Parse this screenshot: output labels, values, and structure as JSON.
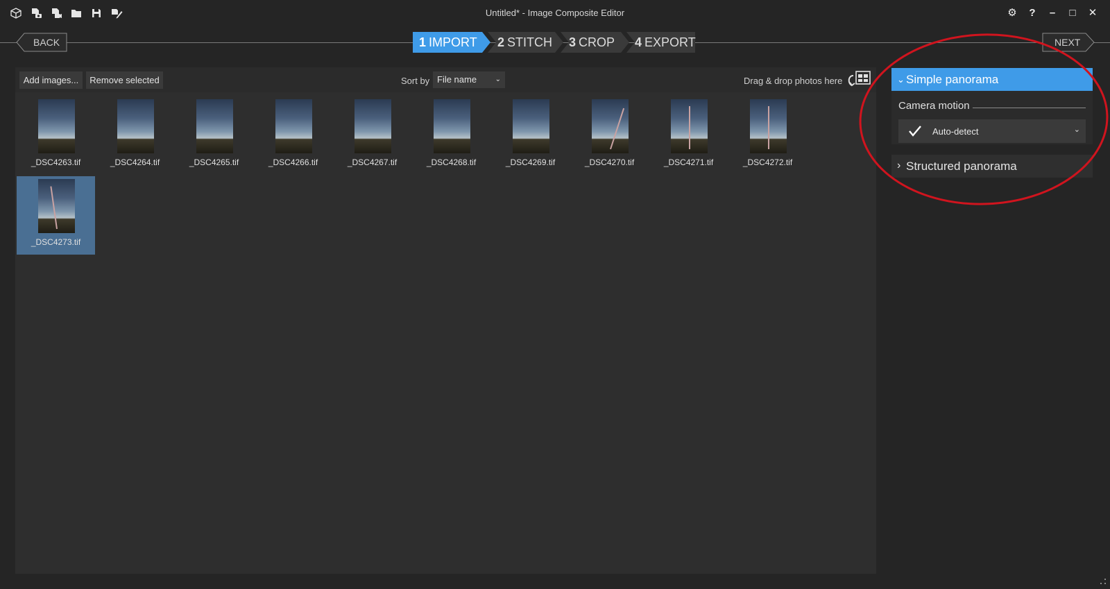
{
  "window": {
    "title": "Untitled* - Image Composite Editor",
    "toolbar_icons": [
      "new-project-icon",
      "import-photo-icon",
      "import-video-icon",
      "open-folder-icon",
      "save-icon",
      "save-as-icon"
    ],
    "controls": {
      "settings": "⚙",
      "help": "?",
      "minimize": "–",
      "maximize": "□",
      "close": "✕"
    }
  },
  "wizard": {
    "back_label": "BACK",
    "next_label": "NEXT",
    "steps": [
      {
        "num": "1",
        "label": "IMPORT",
        "active": true
      },
      {
        "num": "2",
        "label": "STITCH",
        "active": false
      },
      {
        "num": "3",
        "label": "CROP",
        "active": false
      },
      {
        "num": "4",
        "label": "EXPORT",
        "active": false
      }
    ]
  },
  "import_panel": {
    "add_images_label": "Add images...",
    "remove_selected_label": "Remove selected",
    "sort_by_label": "Sort by",
    "sort_value": "File name",
    "drag_hint": "Drag & drop photos here",
    "images": [
      {
        "name": "_DSC4263.tif",
        "selected": false,
        "mast": false
      },
      {
        "name": "_DSC4264.tif",
        "selected": false,
        "mast": false
      },
      {
        "name": "_DSC4265.tif",
        "selected": false,
        "mast": false
      },
      {
        "name": "_DSC4266.tif",
        "selected": false,
        "mast": false
      },
      {
        "name": "_DSC4267.tif",
        "selected": false,
        "mast": false
      },
      {
        "name": "_DSC4268.tif",
        "selected": false,
        "mast": false
      },
      {
        "name": "_DSC4269.tif",
        "selected": false,
        "mast": false
      },
      {
        "name": "_DSC4270.tif",
        "selected": false,
        "mast": true
      },
      {
        "name": "_DSC4271.tif",
        "selected": false,
        "mast": true
      },
      {
        "name": "_DSC4272.tif",
        "selected": false,
        "mast": true
      },
      {
        "name": "_DSC4273.tif",
        "selected": true,
        "mast": true
      }
    ]
  },
  "right_panel": {
    "simple_panorama_label": "Simple panorama",
    "camera_motion_label": "Camera motion",
    "camera_motion_value": "Auto-detect",
    "structured_panorama_label": "Structured panorama",
    "accent_color": "#3f9be8",
    "annotation_color": "#d0141e"
  }
}
